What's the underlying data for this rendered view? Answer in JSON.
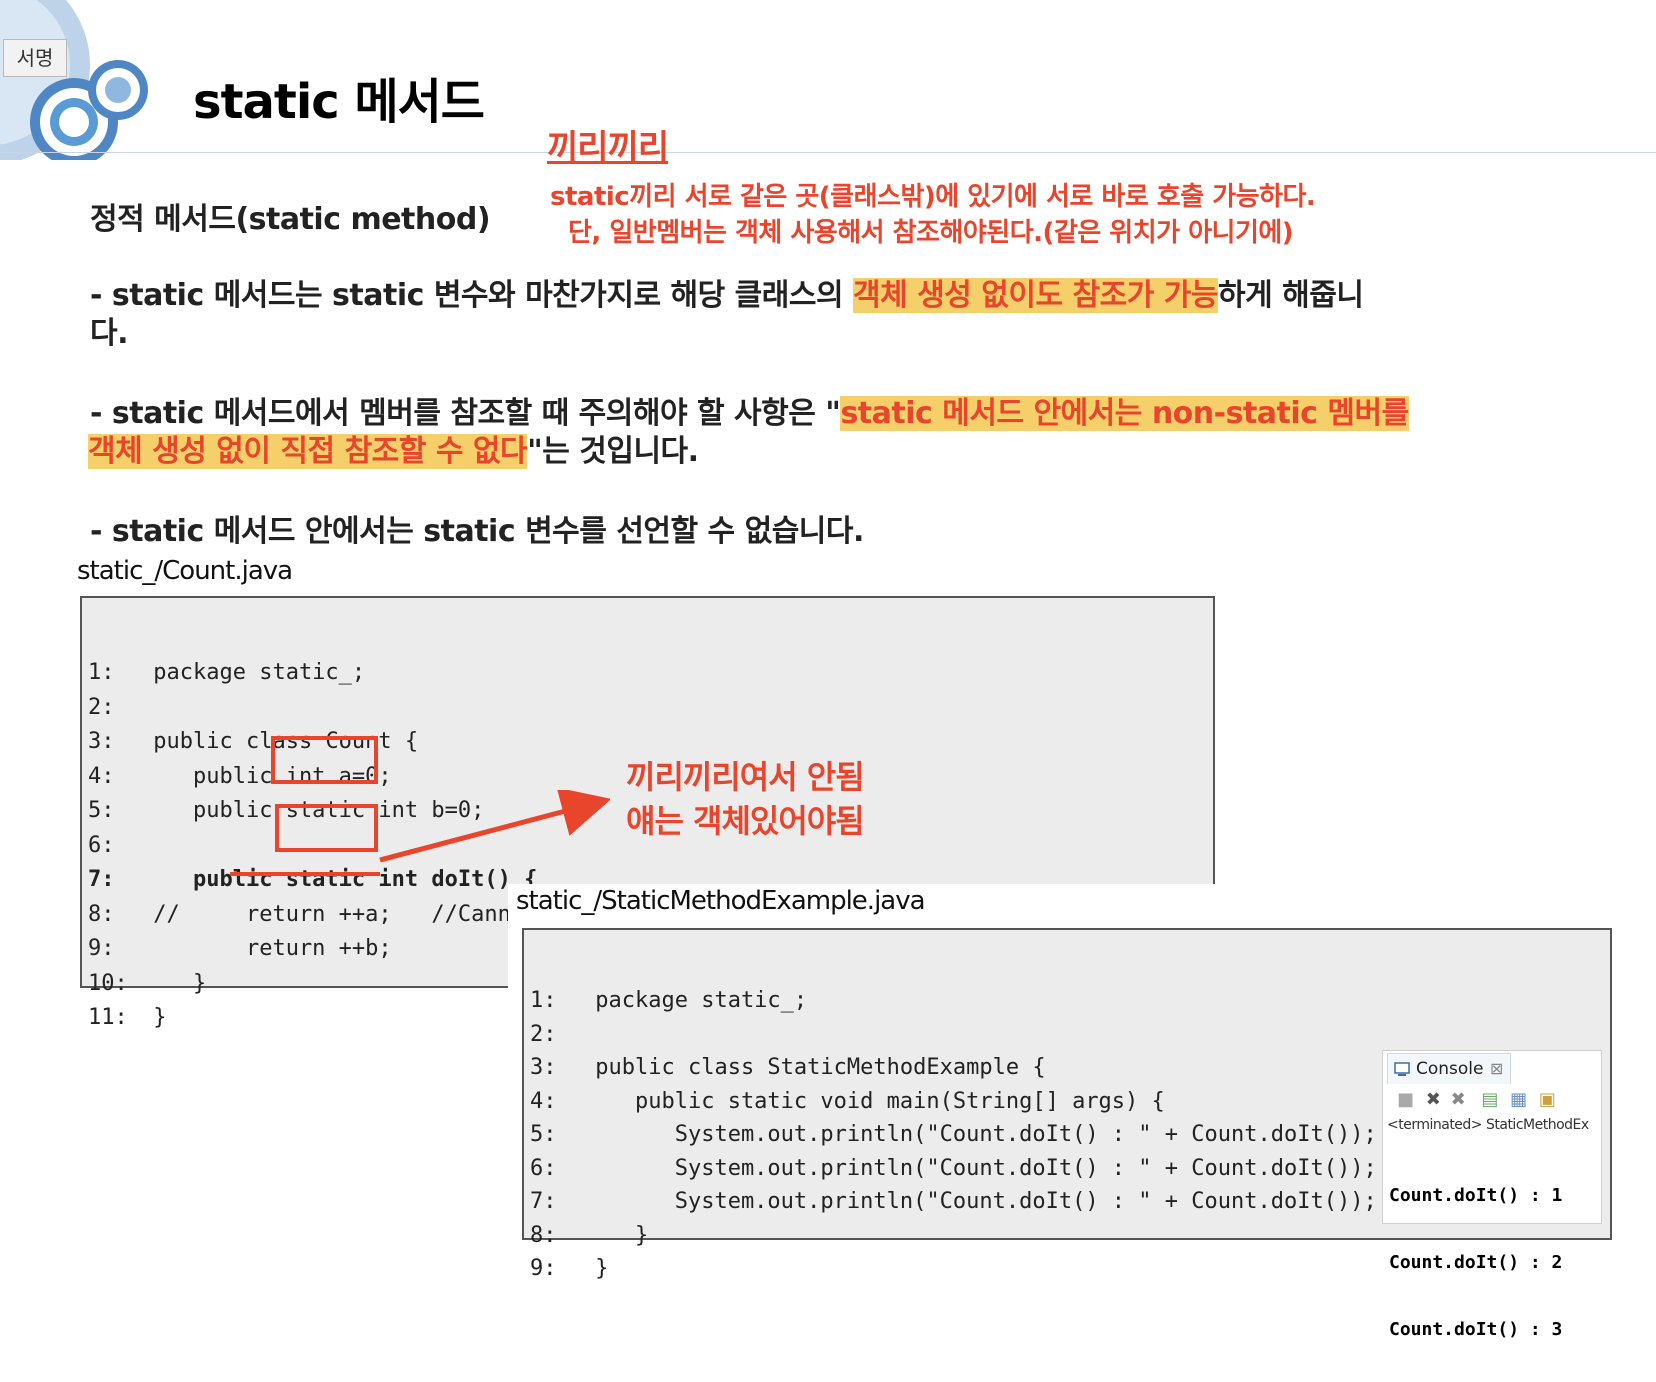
{
  "slide": {
    "badge": "서명",
    "title": "static 메서드",
    "note_title": "끼리끼리",
    "note_line1": "static끼리 서로 같은 곳(클래스밖)에 있기에 서로 바로 호출 가능하다.",
    "note_line2": "단, 일반멤버는 객체 사용해서 참조해야된다.(같은 위치가 아니기에)",
    "heading": "정적 메서드(static method)",
    "p1_a": "- static 메서드는 static 변수와 마찬가지로 해당 클래스의 ",
    "p1_hl": "객체 생성 없이도 참조가 가능",
    "p1_b": "하게 해줍니",
    "p1_c": "다.",
    "p2_a": "- static 메서드에서 멤버를 참조할 때 주의해야 할 사항은 \"",
    "p2_hl1": "static 메서드 안에서는 non-static 멤버를",
    "p2_hl2": "객체 생성 없이 직접 참조할 수 없다",
    "p2_b": "\"는 것입니다.",
    "p3": "- static 메서드 안에서는 static 변수를 선언할 수 없습니다.",
    "annotation_line1": "끼리끼리여서 안됨",
    "annotation_line2": "얘는 객체있어야됨"
  },
  "count_file": {
    "filename": "static_/Count.java",
    "lines": [
      {
        "num": "1:",
        "code": " package static_;"
      },
      {
        "num": "2:",
        "code": ""
      },
      {
        "num": "3:",
        "code": " public class Count {"
      },
      {
        "num": "4:",
        "code": "    public int a=0;"
      },
      {
        "num": "5:",
        "code": "    public static int b=0;"
      },
      {
        "num": "6:",
        "code": ""
      },
      {
        "num": "7:",
        "code": "    public static int doIt() {"
      },
      {
        "num": "8:",
        "code": " //     return ++a;   //Cannot make a static reference to the non-static field a"
      },
      {
        "num": "9:",
        "code": "        return ++b;"
      },
      {
        "num": "10:",
        "code": "    }"
      },
      {
        "num": "11:",
        "code": " }"
      }
    ]
  },
  "example_file": {
    "filename": "static_/StaticMethodExample.java",
    "lines": [
      {
        "num": "1:",
        "code": " package static_;"
      },
      {
        "num": "2:",
        "code": ""
      },
      {
        "num": "3:",
        "code": " public class StaticMethodExample {"
      },
      {
        "num": "4:",
        "code": "    public static void main(String[] args) {"
      },
      {
        "num": "5:",
        "code": "       System.out.println(\"Count.doIt() : \" + Count.doIt());"
      },
      {
        "num": "6:",
        "code": "       System.out.println(\"Count.doIt() : \" + Count.doIt());"
      },
      {
        "num": "7:",
        "code": "       System.out.println(\"Count.doIt() : \" + Count.doIt());"
      },
      {
        "num": "8:",
        "code": "    }"
      },
      {
        "num": "9:",
        "code": " }"
      }
    ]
  },
  "console": {
    "tab_label": "Console",
    "terminated": "<terminated> StaticMethodEx",
    "output": [
      "Count.doIt() : 1",
      "Count.doIt() : 2",
      "Count.doIt() : 3"
    ],
    "icons": [
      "console-icon",
      "close-tab-icon",
      "stop-icon",
      "remove-launch-icon",
      "remove-all-icon",
      "scroll-lock-icon",
      "pin-icon",
      "display-selected-icon",
      "open-console-icon"
    ]
  },
  "colors": {
    "accent_red": "#e8452c",
    "highlight": "#f4cf6a",
    "code_bg": "#ececec",
    "deco_blue": "#5b9bd5"
  }
}
